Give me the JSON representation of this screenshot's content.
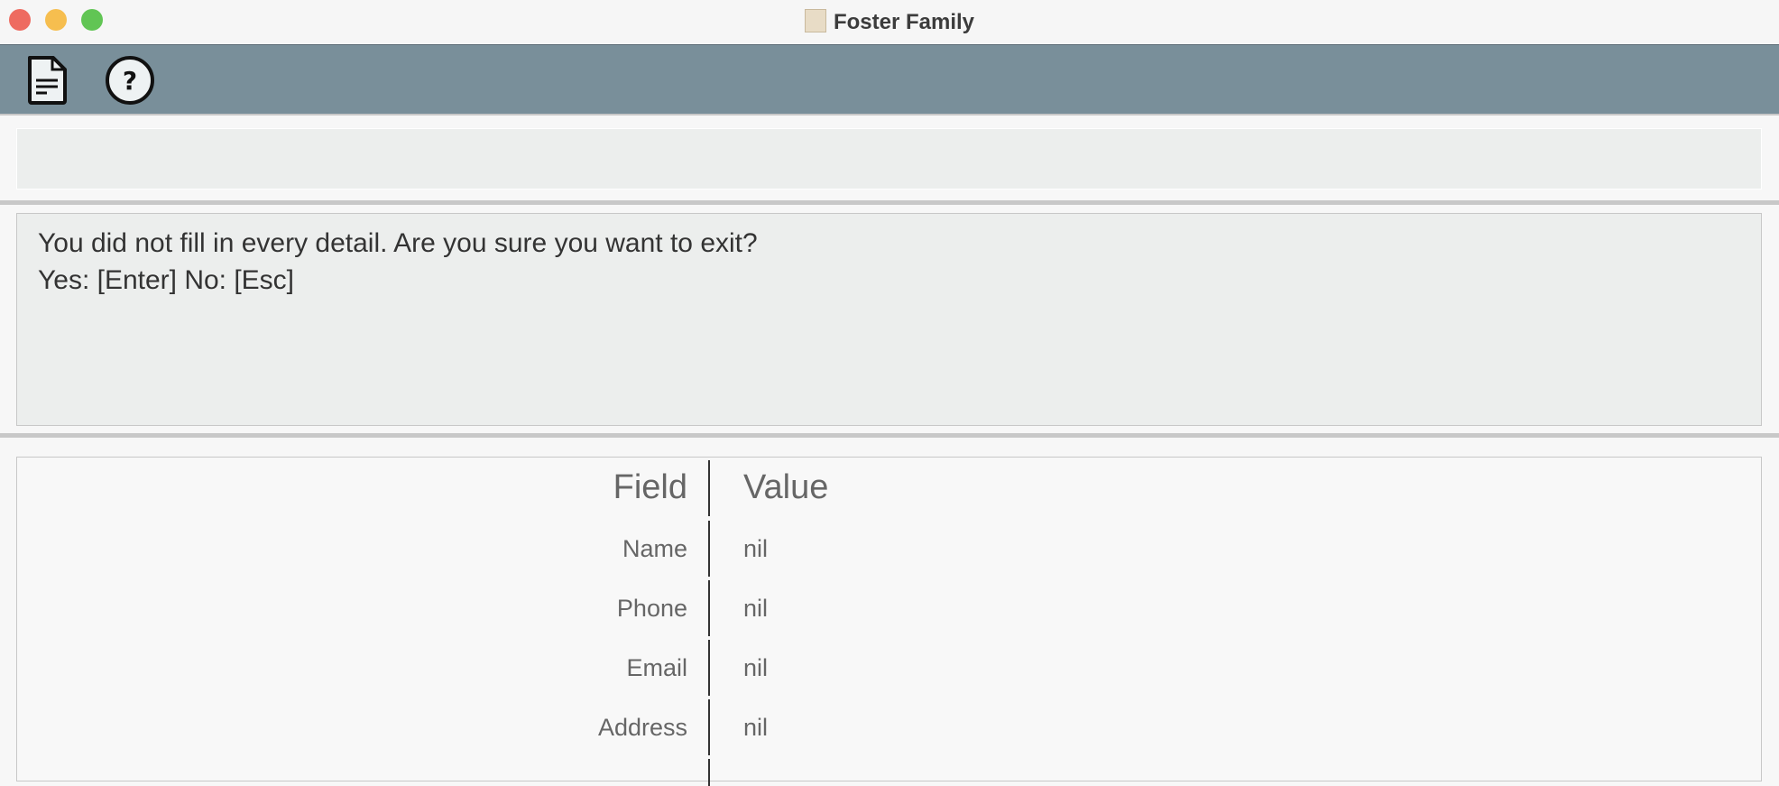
{
  "window": {
    "title": "Foster Family"
  },
  "toolbar": {
    "buttons": [
      {
        "icon": "document-icon",
        "name": "file"
      },
      {
        "icon": "help-icon",
        "name": "help"
      }
    ]
  },
  "command_box": {
    "value": ""
  },
  "result_display": {
    "lines": [
      "You did not fill in every detail. Are you sure you want to exit?",
      "Yes: [Enter] No: [Esc]"
    ]
  },
  "details_table": {
    "headers": {
      "field": "Field",
      "value": "Value"
    },
    "rows": [
      {
        "field": "Name",
        "value": "nil"
      },
      {
        "field": "Phone",
        "value": "nil"
      },
      {
        "field": "Email",
        "value": "nil"
      },
      {
        "field": "Address",
        "value": "nil"
      }
    ]
  }
}
